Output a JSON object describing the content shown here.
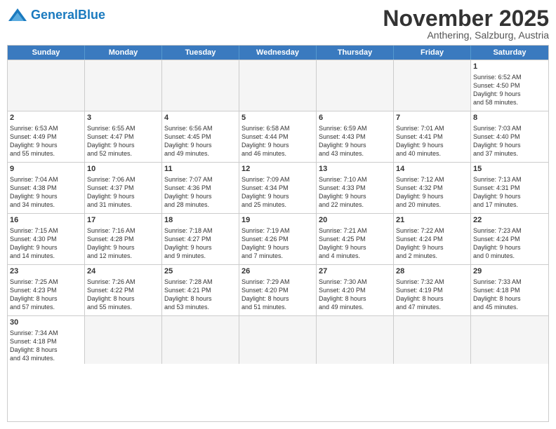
{
  "logo": {
    "text_general": "General",
    "text_blue": "Blue"
  },
  "title": "November 2025",
  "subtitle": "Anthering, Salzburg, Austria",
  "header_days": [
    "Sunday",
    "Monday",
    "Tuesday",
    "Wednesday",
    "Thursday",
    "Friday",
    "Saturday"
  ],
  "weeks": [
    [
      {
        "day": "",
        "info": ""
      },
      {
        "day": "",
        "info": ""
      },
      {
        "day": "",
        "info": ""
      },
      {
        "day": "",
        "info": ""
      },
      {
        "day": "",
        "info": ""
      },
      {
        "day": "",
        "info": ""
      },
      {
        "day": "1",
        "info": "Sunrise: 6:52 AM\nSunset: 4:50 PM\nDaylight: 9 hours\nand 58 minutes."
      }
    ],
    [
      {
        "day": "2",
        "info": "Sunrise: 6:53 AM\nSunset: 4:49 PM\nDaylight: 9 hours\nand 55 minutes."
      },
      {
        "day": "3",
        "info": "Sunrise: 6:55 AM\nSunset: 4:47 PM\nDaylight: 9 hours\nand 52 minutes."
      },
      {
        "day": "4",
        "info": "Sunrise: 6:56 AM\nSunset: 4:45 PM\nDaylight: 9 hours\nand 49 minutes."
      },
      {
        "day": "5",
        "info": "Sunrise: 6:58 AM\nSunset: 4:44 PM\nDaylight: 9 hours\nand 46 minutes."
      },
      {
        "day": "6",
        "info": "Sunrise: 6:59 AM\nSunset: 4:43 PM\nDaylight: 9 hours\nand 43 minutes."
      },
      {
        "day": "7",
        "info": "Sunrise: 7:01 AM\nSunset: 4:41 PM\nDaylight: 9 hours\nand 40 minutes."
      },
      {
        "day": "8",
        "info": "Sunrise: 7:03 AM\nSunset: 4:40 PM\nDaylight: 9 hours\nand 37 minutes."
      }
    ],
    [
      {
        "day": "9",
        "info": "Sunrise: 7:04 AM\nSunset: 4:38 PM\nDaylight: 9 hours\nand 34 minutes."
      },
      {
        "day": "10",
        "info": "Sunrise: 7:06 AM\nSunset: 4:37 PM\nDaylight: 9 hours\nand 31 minutes."
      },
      {
        "day": "11",
        "info": "Sunrise: 7:07 AM\nSunset: 4:36 PM\nDaylight: 9 hours\nand 28 minutes."
      },
      {
        "day": "12",
        "info": "Sunrise: 7:09 AM\nSunset: 4:34 PM\nDaylight: 9 hours\nand 25 minutes."
      },
      {
        "day": "13",
        "info": "Sunrise: 7:10 AM\nSunset: 4:33 PM\nDaylight: 9 hours\nand 22 minutes."
      },
      {
        "day": "14",
        "info": "Sunrise: 7:12 AM\nSunset: 4:32 PM\nDaylight: 9 hours\nand 20 minutes."
      },
      {
        "day": "15",
        "info": "Sunrise: 7:13 AM\nSunset: 4:31 PM\nDaylight: 9 hours\nand 17 minutes."
      }
    ],
    [
      {
        "day": "16",
        "info": "Sunrise: 7:15 AM\nSunset: 4:30 PM\nDaylight: 9 hours\nand 14 minutes."
      },
      {
        "day": "17",
        "info": "Sunrise: 7:16 AM\nSunset: 4:28 PM\nDaylight: 9 hours\nand 12 minutes."
      },
      {
        "day": "18",
        "info": "Sunrise: 7:18 AM\nSunset: 4:27 PM\nDaylight: 9 hours\nand 9 minutes."
      },
      {
        "day": "19",
        "info": "Sunrise: 7:19 AM\nSunset: 4:26 PM\nDaylight: 9 hours\nand 7 minutes."
      },
      {
        "day": "20",
        "info": "Sunrise: 7:21 AM\nSunset: 4:25 PM\nDaylight: 9 hours\nand 4 minutes."
      },
      {
        "day": "21",
        "info": "Sunrise: 7:22 AM\nSunset: 4:24 PM\nDaylight: 9 hours\nand 2 minutes."
      },
      {
        "day": "22",
        "info": "Sunrise: 7:23 AM\nSunset: 4:24 PM\nDaylight: 9 hours\nand 0 minutes."
      }
    ],
    [
      {
        "day": "23",
        "info": "Sunrise: 7:25 AM\nSunset: 4:23 PM\nDaylight: 8 hours\nand 57 minutes."
      },
      {
        "day": "24",
        "info": "Sunrise: 7:26 AM\nSunset: 4:22 PM\nDaylight: 8 hours\nand 55 minutes."
      },
      {
        "day": "25",
        "info": "Sunrise: 7:28 AM\nSunset: 4:21 PM\nDaylight: 8 hours\nand 53 minutes."
      },
      {
        "day": "26",
        "info": "Sunrise: 7:29 AM\nSunset: 4:20 PM\nDaylight: 8 hours\nand 51 minutes."
      },
      {
        "day": "27",
        "info": "Sunrise: 7:30 AM\nSunset: 4:20 PM\nDaylight: 8 hours\nand 49 minutes."
      },
      {
        "day": "28",
        "info": "Sunrise: 7:32 AM\nSunset: 4:19 PM\nDaylight: 8 hours\nand 47 minutes."
      },
      {
        "day": "29",
        "info": "Sunrise: 7:33 AM\nSunset: 4:18 PM\nDaylight: 8 hours\nand 45 minutes."
      }
    ],
    [
      {
        "day": "30",
        "info": "Sunrise: 7:34 AM\nSunset: 4:18 PM\nDaylight: 8 hours\nand 43 minutes."
      },
      {
        "day": "",
        "info": ""
      },
      {
        "day": "",
        "info": ""
      },
      {
        "day": "",
        "info": ""
      },
      {
        "day": "",
        "info": ""
      },
      {
        "day": "",
        "info": ""
      },
      {
        "day": "",
        "info": ""
      }
    ]
  ]
}
